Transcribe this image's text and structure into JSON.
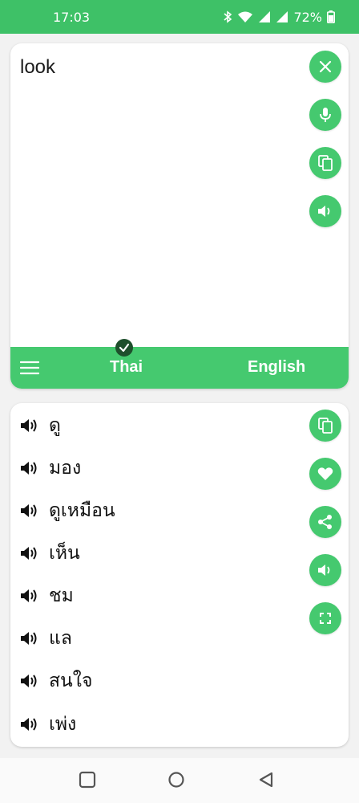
{
  "status_bar": {
    "time": "17:03",
    "battery": "72%",
    "icons": [
      "bluetooth-icon",
      "wifi-icon",
      "signal-icon",
      "signal-icon",
      "battery-icon"
    ]
  },
  "input": {
    "text": "look",
    "actions": [
      "close-icon",
      "mic-icon",
      "copy-icon",
      "speaker-icon"
    ]
  },
  "language_bar": {
    "source": "Thai",
    "target": "English"
  },
  "results": {
    "items": [
      {
        "word": "ดู"
      },
      {
        "word": "มอง"
      },
      {
        "word": "ดูเหมือน"
      },
      {
        "word": "เห็น"
      },
      {
        "word": "ชม"
      },
      {
        "word": "แล"
      },
      {
        "word": "สนใจ"
      },
      {
        "word": "เพ่ง"
      }
    ],
    "actions": [
      "copy-icon",
      "heart-icon",
      "share-icon",
      "speaker-icon",
      "fullscreen-icon"
    ]
  },
  "colors": {
    "status_bar": "#3ec167",
    "accent": "#45c96f",
    "check_badge": "#1e4f2c"
  }
}
